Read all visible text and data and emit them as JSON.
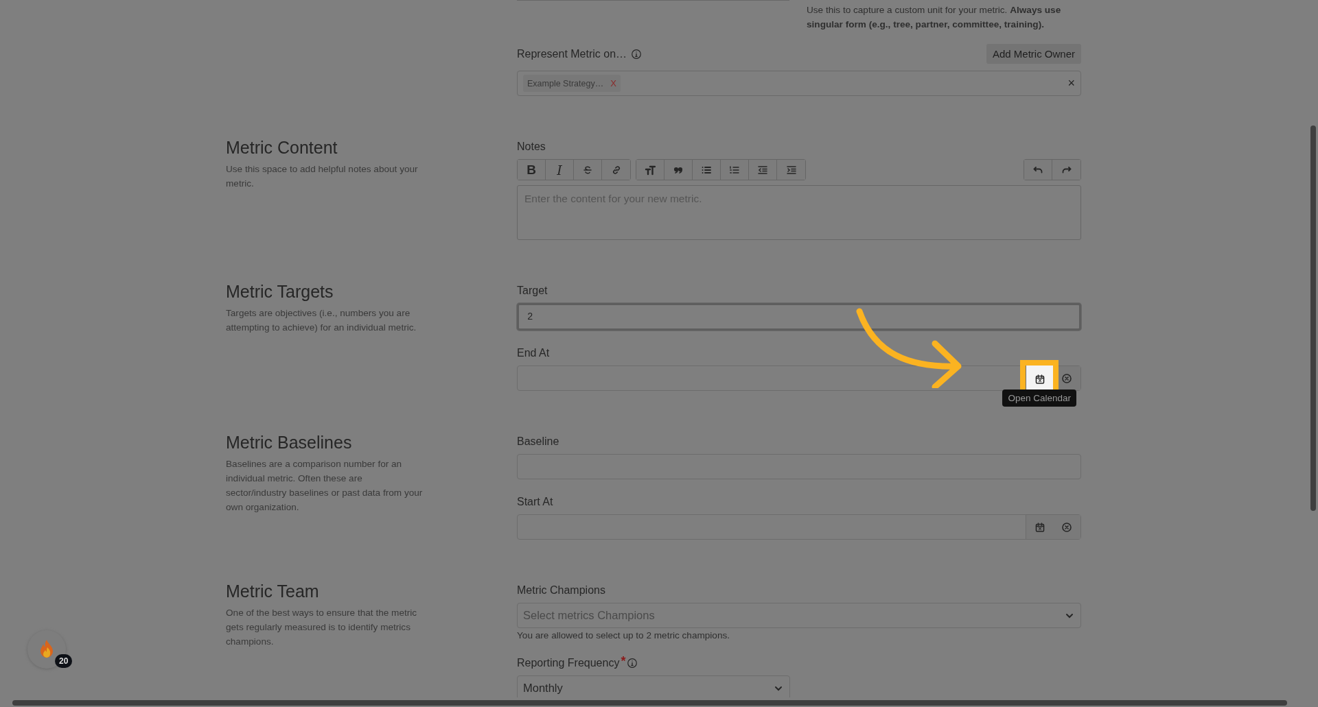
{
  "top": {
    "help": "Use this to capture a custom unit for your metric. **Always use singular form (e.g., tree, partner, committee, training).**"
  },
  "represent": {
    "label": "Represent Metric on…",
    "button": "Add Metric Owner",
    "tags": [
      {
        "label": "Example Strategy…",
        "remove": "X"
      }
    ],
    "clear": "×"
  },
  "sections": [
    {
      "title": "Metric Content",
      "description": "Use this space to add helpful notes about your metric.",
      "fields": [
        {
          "kind": "editor",
          "label": "Notes",
          "placeholder": "Enter the content for your new metric.",
          "toolbar": [
            [
              {
                "kind": "bold",
                "label": "B"
              },
              {
                "kind": "italic",
                "label": "I"
              },
              {
                "kind": "strike"
              },
              {
                "kind": "link"
              }
            ],
            [
              {
                "kind": "heading"
              },
              {
                "kind": "quote"
              },
              {
                "kind": "bullets"
              },
              {
                "kind": "numbers"
              },
              {
                "kind": "outdent"
              },
              {
                "kind": "indent"
              }
            ]
          ],
          "history": [
            {
              "kind": "undo"
            },
            {
              "kind": "redo"
            }
          ]
        }
      ]
    },
    {
      "title": "Metric Targets",
      "description": "Targets are objectives (i.e., numbers you are attempting to achieve) for an individual metric.",
      "fields": [
        {
          "kind": "text",
          "label": "Target",
          "value": "2",
          "focused": true
        },
        {
          "kind": "date",
          "label": "End At",
          "highlighted": true,
          "tooltip": "Open Calendar"
        }
      ]
    },
    {
      "title": "Metric Baselines",
      "description": "Baselines are a comparison number for an individual metric. Often these are sector/industry baselines or past data from your own organization.",
      "fields": [
        {
          "kind": "text",
          "label": "Baseline",
          "focused": false
        },
        {
          "kind": "date",
          "label": "Start At",
          "highlighted": false
        }
      ]
    },
    {
      "title": "Metric Team",
      "description": "One of the best ways to ensure that the metric gets regularly measured is to identify metrics champions.",
      "fields": [
        {
          "kind": "select",
          "label": "Metric Champions",
          "placeholder": "Select metrics Champions",
          "help": "You are allowed to select up to 2 metric champions."
        },
        {
          "kind": "short-select",
          "label": "Reporting Frequency",
          "required": true,
          "required_mark": "*",
          "info": true,
          "value": "Monthly"
        }
      ]
    }
  ],
  "badge": {
    "count": "20"
  }
}
